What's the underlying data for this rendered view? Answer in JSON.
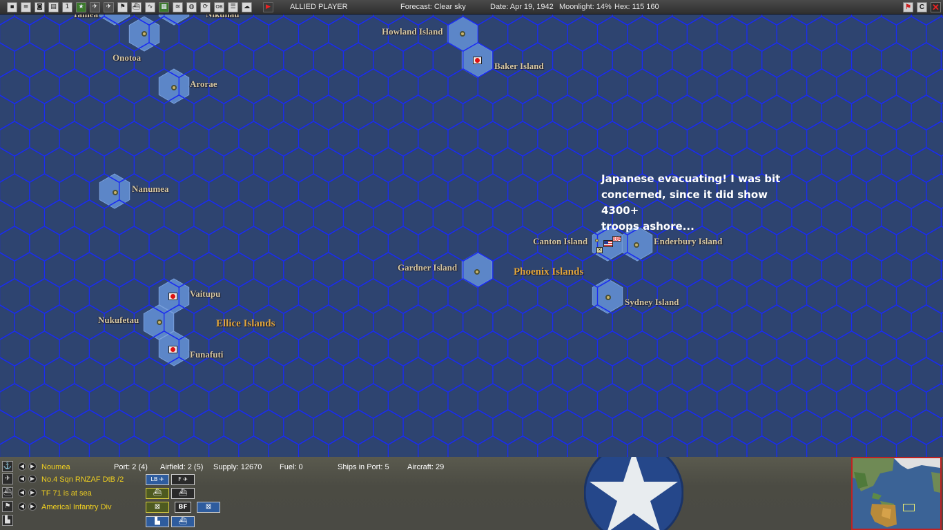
{
  "toolbar": {
    "player_label": "ALLIED PLAYER",
    "forecast": "Forecast: Clear sky",
    "date": "Date: Apr 19, 1942",
    "moonlight": "Moonlight: 14%",
    "hex": "Hex: 115 160",
    "icons": [
      "options-icon",
      "document-icon",
      "camera-icon",
      "report-icon",
      "info-icon",
      "star-icon",
      "plane-icon",
      "plane-icon",
      "flag-icon",
      "ship-icon",
      "chart-icon",
      "map-icon",
      "fleet-icon",
      "globe-icon",
      "cycle-icon",
      "ob-icon",
      "menu-icon",
      "weather-icon",
      "play-icon"
    ],
    "ob_label": "OB",
    "info_label": "1",
    "window_buttons": {
      "flag": "",
      "c": "C",
      "close": "✕"
    }
  },
  "map": {
    "ocean_color": "#2e4470",
    "grid_color": "#1a2cf0",
    "places": [
      {
        "id": "tarawa",
        "name": "Tamea"
      },
      {
        "id": "nikunau",
        "name": "Nikunau"
      },
      {
        "id": "howland",
        "name": "Howland Island"
      },
      {
        "id": "onotoa",
        "name": "Onotoa"
      },
      {
        "id": "baker",
        "name": "Baker Island"
      },
      {
        "id": "arorae",
        "name": "Arorae"
      },
      {
        "id": "nanumea",
        "name": "Nanumea"
      },
      {
        "id": "canton",
        "name": "Canton Island"
      },
      {
        "id": "enderbury",
        "name": "Enderbury Island"
      },
      {
        "id": "gardner",
        "name": "Gardner Island"
      },
      {
        "id": "sydney",
        "name": "Sydney Island"
      },
      {
        "id": "vaitupu",
        "name": "Vaitupu"
      },
      {
        "id": "nukufetau",
        "name": "Nukufetau"
      },
      {
        "id": "funafuti",
        "name": "Funafuti"
      }
    ],
    "groups": [
      {
        "id": "phoenix",
        "name": "Phoenix Islands"
      },
      {
        "id": "ellice",
        "name": "Ellice Islands"
      }
    ],
    "annotation": "Japanese evacuating! I was bit\nconcerned, since it did show 4300+\ntroops ashore..."
  },
  "bottom": {
    "rows": [
      {
        "icon": "anchor-icon",
        "label": "Noumea"
      },
      {
        "icon": "aircraft-icon",
        "label": "No.4 Sqn RNZAF DtB /2"
      },
      {
        "icon": "ship-icon",
        "label": "TF 71 is at sea"
      },
      {
        "icon": "flag-icon",
        "label": "Americal Infantry Div"
      },
      {
        "icon": "factory-icon",
        "label": ""
      }
    ],
    "stats": {
      "port": "Port: 2 (4)",
      "airfield": "Airfield: 2 (5)",
      "supply": "Supply: 12670",
      "fuel": "Fuel: 0",
      "ships_in_port": "Ships in Port: 5",
      "aircraft": "Aircraft: 29"
    },
    "buttons": {
      "lb": "LB",
      "f": "F",
      "bf": "BF"
    }
  },
  "colors": {
    "japan_red": "#d11111",
    "label_gold": "#e0a53c",
    "row_yellow": "#f0d020",
    "minimap_frame": "#c02222"
  }
}
